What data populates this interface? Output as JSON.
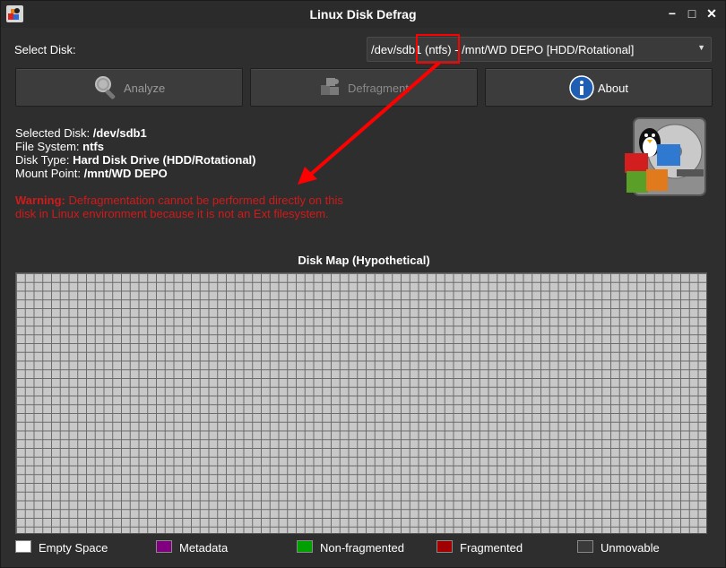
{
  "window": {
    "title": "Linux Disk Defrag"
  },
  "controls": {
    "minimize": "−",
    "maximize": "□",
    "close": "✕"
  },
  "select_disk": {
    "label": "Select Disk:",
    "value": "/dev/sdb1 (ntfs) - /mnt/WD DEPO [HDD/Rotational]"
  },
  "buttons": {
    "analyze": "Analyze",
    "defragment": "Defragment",
    "about": "About"
  },
  "details": {
    "selected_disk_label": "Selected Disk:",
    "selected_disk": "/dev/sdb1",
    "file_system_label": "File System:",
    "file_system": "ntfs",
    "disk_type_label": "Disk Type:",
    "disk_type": "Hard Disk Drive (HDD/Rotational)",
    "mount_point_label": "Mount Point:",
    "mount_point": "/mnt/WD DEPO"
  },
  "warning": {
    "prefix": "Warning:",
    "text": "Defragmentation cannot be performed directly on this disk in Linux environment because it is not an Ext filesystem."
  },
  "disk_map": {
    "title": "Disk Map (Hypothetical)"
  },
  "legend": [
    {
      "label": "Empty Space",
      "color": "#ffffff"
    },
    {
      "label": "Metadata",
      "color": "#800080"
    },
    {
      "label": "Non-fragmented",
      "color": "#00a000"
    },
    {
      "label": "Fragmented",
      "color": "#a00000"
    },
    {
      "label": "Unmovable",
      "color": "#3a3a3a"
    }
  ],
  "colors": {
    "warning": "#d11a1a",
    "annotation": "#ff0000",
    "about_icon": "#1e5fb4"
  }
}
